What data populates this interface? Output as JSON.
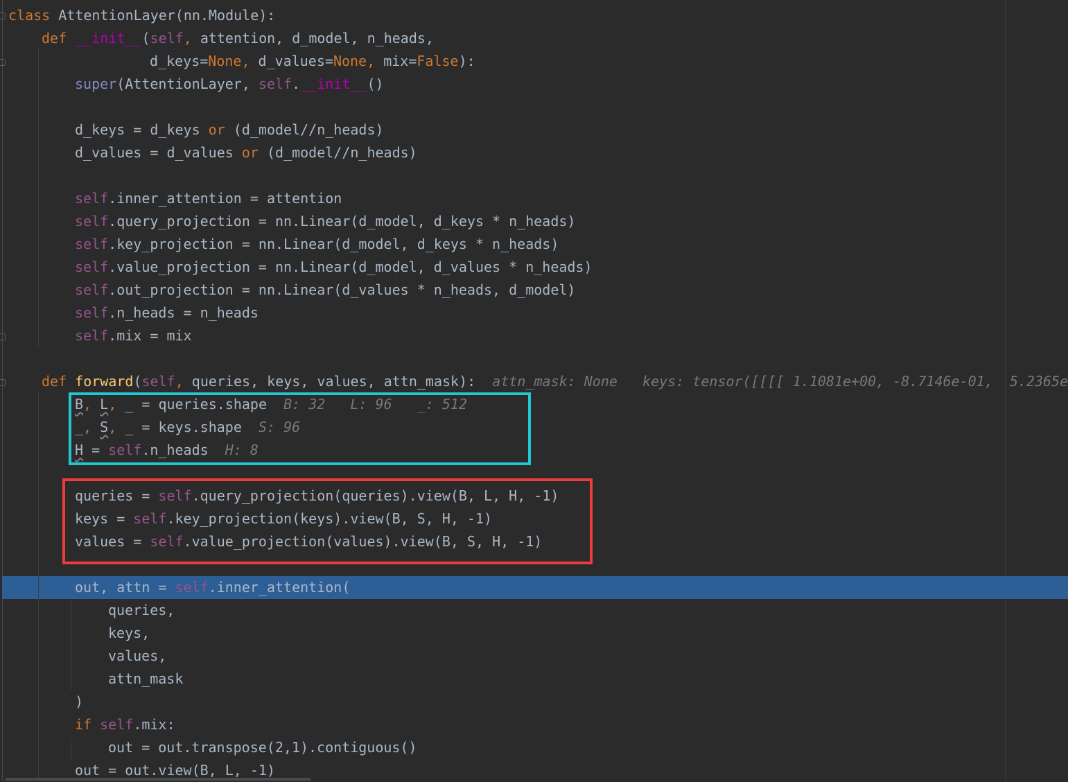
{
  "editor": {
    "class_kw": "class",
    "class_name": "AttentionLayer",
    "class_base_open": "(nn.Module):",
    "def_kw": "def",
    "init_name": "__init__",
    "init_sig_self": "self",
    "init_sig_rest": "attention, d_model, n_heads,",
    "init_cont_1": "d_keys=",
    "none_lit": "None",
    "init_cont_2": " d_values=",
    "init_cont_3": " mix=",
    "false_lit": "False",
    "init_cont_end": "):",
    "super_call": "super",
    "super_args": "(AttentionLayer, ",
    "init_tail": "()",
    "dkeys_lhs": "d_keys = d_keys ",
    "or_kw": "or",
    "dkeys_rhs": " (d_model//n_heads)",
    "dvalues_lhs": "d_values = d_values ",
    "dvalues_rhs": " (d_model//n_heads)",
    "self_kw": "self",
    "inner_attn_assign": ".inner_attention = attention",
    "qproj_assign": ".query_projection = nn.Linear(d_model, d_keys * n_heads)",
    "kproj_assign": ".key_projection = nn.Linear(d_model, d_keys * n_heads)",
    "vproj_assign": ".value_projection = nn.Linear(d_model, d_values * n_heads)",
    "oproj_assign": ".out_projection = nn.Linear(d_values * n_heads, d_model)",
    "nheads_assign": ".n_heads = n_heads",
    "mix_assign": ".mix = mix",
    "forward_name": "forward",
    "forward_params": "queries, keys, values, attn_mask):",
    "hint_attn_mask": "attn_mask: None",
    "hint_keys": "keys: tensor([[[[ 1.1081e+00, -8.7146e-01,  5.2365e",
    "shape_b": "B",
    "shape_l": "L",
    "shape_rest": " = queries.shape",
    "hint_b": "B: 32",
    "hint_l": "L: 96",
    "hint_u": "_: 512",
    "shape_s": "S",
    "keys_shape_rest": " = keys.shape",
    "hint_s": "S: 96",
    "h_var": "H",
    "h_assign_rest": ".n_heads",
    "hint_h": "H: 8",
    "q_view_lhs": "queries = ",
    "q_view_rhs": ".query_projection(queries).view(B, L, H, -1)",
    "k_view_lhs": "keys = ",
    "k_view_rhs": ".key_projection(keys).view(B, S, H, -1)",
    "v_view_lhs": "values = ",
    "v_view_rhs": ".value_projection(values).view(B, S, H, -1)",
    "out_attn_lhs": "out, attn = ",
    "inner_call": ".inner_attention(",
    "arg_queries": "queries,",
    "arg_keys": "keys,",
    "arg_values": "values,",
    "arg_mask": "attn_mask",
    "close_paren": ")",
    "if_kw": "if",
    "if_rest": ".mix:",
    "transpose_line": "out = out.transpose(2,1).contiguous()",
    "view_line": "out = out.view(B, L, -1)"
  },
  "colors": {
    "background": "#2b2b2b",
    "execution_line": "#2d5e95",
    "cyan_box": "#22c7d2",
    "red_box": "#ee3b3b"
  }
}
